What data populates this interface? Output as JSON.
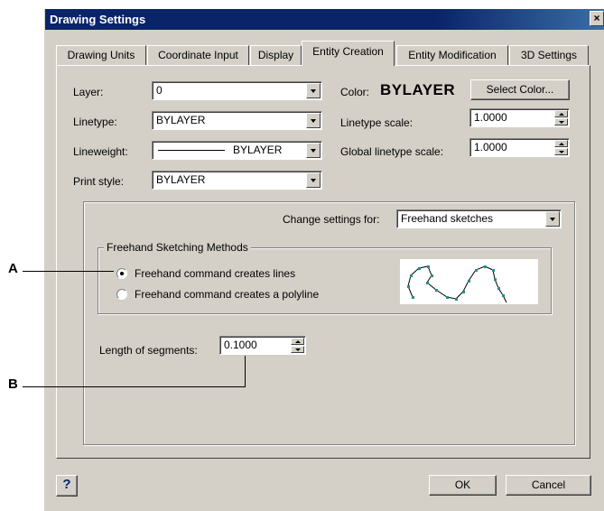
{
  "window": {
    "title": "Drawing Settings",
    "close_label": "×"
  },
  "tabs": [
    {
      "label": "Drawing Units"
    },
    {
      "label": "Coordinate Input"
    },
    {
      "label": "Display"
    },
    {
      "label": "Entity Creation"
    },
    {
      "label": "Entity Modification"
    },
    {
      "label": "3D Settings"
    }
  ],
  "active_tab": "Entity Creation",
  "entity_creation": {
    "layer_label": "Layer:",
    "layer_value": "0",
    "linetype_label": "Linetype:",
    "linetype_value": "BYLAYER",
    "lineweight_label": "Lineweight:",
    "lineweight_value": "BYLAYER",
    "print_style_label": "Print style:",
    "print_style_value": "BYLAYER",
    "color_label": "Color:",
    "color_value": "BYLAYER",
    "select_color_button": "Select Color...",
    "linetype_scale_label": "Linetype scale:",
    "linetype_scale_value": "1.0000",
    "global_linetype_scale_label": "Global linetype scale:",
    "global_linetype_scale_value": "1.0000"
  },
  "change_settings": {
    "label": "Change settings for:",
    "value": "Freehand sketches"
  },
  "freehand_group": {
    "title": "Freehand Sketching Methods",
    "options": [
      {
        "label": "Freehand command creates lines",
        "selected": true
      },
      {
        "label": "Freehand command creates a polyline",
        "selected": false
      }
    ]
  },
  "segments": {
    "label": "Length of segments:",
    "value": "0.1000"
  },
  "footer": {
    "help_label": "?",
    "ok_label": "OK",
    "cancel_label": "Cancel"
  },
  "callouts": {
    "a": "A",
    "b": "B"
  },
  "colors": {
    "titlebar": "#0a246a",
    "dialog_face": "#d4d0c8",
    "preview_point": "#2a8a8a"
  }
}
